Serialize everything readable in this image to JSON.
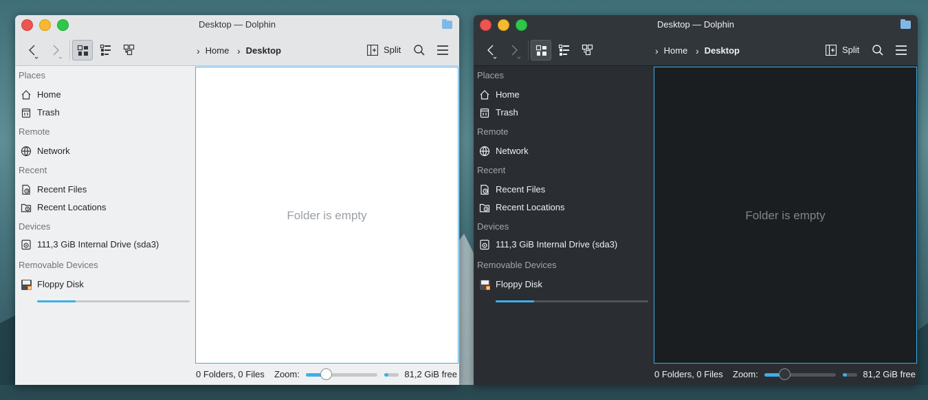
{
  "windows": [
    {
      "theme": "light",
      "title": "Desktop — Dolphin",
      "breadcrumb": [
        "Home",
        "Desktop"
      ],
      "split_label": "Split",
      "sidebar": {
        "sections": [
          {
            "title": "Places",
            "items": [
              {
                "label": "Home",
                "icon": "home-icon"
              },
              {
                "label": "Trash",
                "icon": "trash-icon"
              }
            ]
          },
          {
            "title": "Remote",
            "items": [
              {
                "label": "Network",
                "icon": "network-icon"
              }
            ]
          },
          {
            "title": "Recent",
            "items": [
              {
                "label": "Recent Files",
                "icon": "recent-files-icon"
              },
              {
                "label": "Recent Locations",
                "icon": "recent-locations-icon"
              }
            ]
          },
          {
            "title": "Devices",
            "items": [
              {
                "label": "111,3 GiB Internal Drive (sda3)",
                "icon": "drive-icon",
                "usage_fraction": 0.25
              }
            ]
          },
          {
            "title": "Removable Devices",
            "items": [
              {
                "label": "Floppy Disk",
                "icon": "floppy-icon"
              }
            ]
          }
        ]
      },
      "view": {
        "empty_text": "Folder is empty"
      },
      "status": {
        "count": "0 Folders, 0 Files",
        "zoom_label": "Zoom:",
        "zoom_fraction": 0.3,
        "free": "81,2 GiB free",
        "free_fraction": 0.27
      }
    },
    {
      "theme": "dark",
      "title": "Desktop — Dolphin",
      "breadcrumb": [
        "Home",
        "Desktop"
      ],
      "split_label": "Split",
      "sidebar": {
        "sections": [
          {
            "title": "Places",
            "items": [
              {
                "label": "Home",
                "icon": "home-icon"
              },
              {
                "label": "Trash",
                "icon": "trash-icon"
              }
            ]
          },
          {
            "title": "Remote",
            "items": [
              {
                "label": "Network",
                "icon": "network-icon"
              }
            ]
          },
          {
            "title": "Recent",
            "items": [
              {
                "label": "Recent Files",
                "icon": "recent-files-icon"
              },
              {
                "label": "Recent Locations",
                "icon": "recent-locations-icon"
              }
            ]
          },
          {
            "title": "Devices",
            "items": [
              {
                "label": "111,3 GiB Internal Drive (sda3)",
                "icon": "drive-icon",
                "usage_fraction": 0.25
              }
            ]
          },
          {
            "title": "Removable Devices",
            "items": [
              {
                "label": "Floppy Disk",
                "icon": "floppy-icon"
              }
            ]
          }
        ]
      },
      "view": {
        "empty_text": "Folder is empty"
      },
      "status": {
        "count": "0 Folders, 0 Files",
        "zoom_label": "Zoom:",
        "zoom_fraction": 0.3,
        "free": "81,2 GiB free",
        "free_fraction": 0.27
      }
    }
  ],
  "colors": {
    "accent": "#3daee9",
    "close": "#ee5550",
    "minimize": "#f7b92f",
    "maximize": "#2fc74a"
  }
}
